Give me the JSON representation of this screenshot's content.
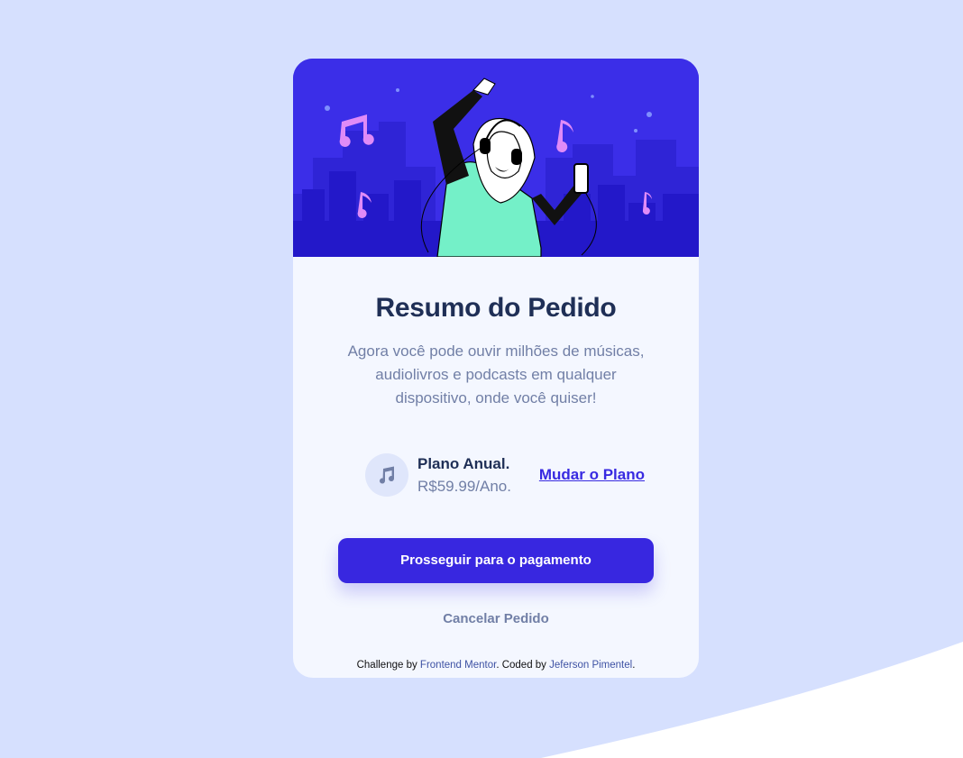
{
  "colors": {
    "page_background": "#d6e0fe",
    "card_background": "#f4f7ff",
    "hero_background": "#3b2ee8",
    "primary": "#3827e0",
    "dark_blue": "#1f2f56",
    "desaturated_blue": "#717fa6",
    "pale_blue": "#dfe6fb"
  },
  "icons": {
    "hero": "music-illustration",
    "plan": "music-note-icon"
  },
  "card": {
    "title": "Resumo do Pedido",
    "description": "Agora você pode ouvir milhões de músicas, audiolivros e podcasts em qualquer dispositivo, onde você quiser!",
    "plan": {
      "name": "Plano Anual.",
      "price": "R$59.99/Ano.",
      "change_label": "Mudar o Plano"
    },
    "pay_button": "Prosseguir para o pagamento",
    "cancel_button": "Cancelar Pedido"
  },
  "attribution": {
    "prefix": "Challenge by ",
    "frontend_mentor": "Frontend Mentor",
    "middle": ". Coded by ",
    "author": "Jeferson Pimentel",
    "suffix": "."
  }
}
